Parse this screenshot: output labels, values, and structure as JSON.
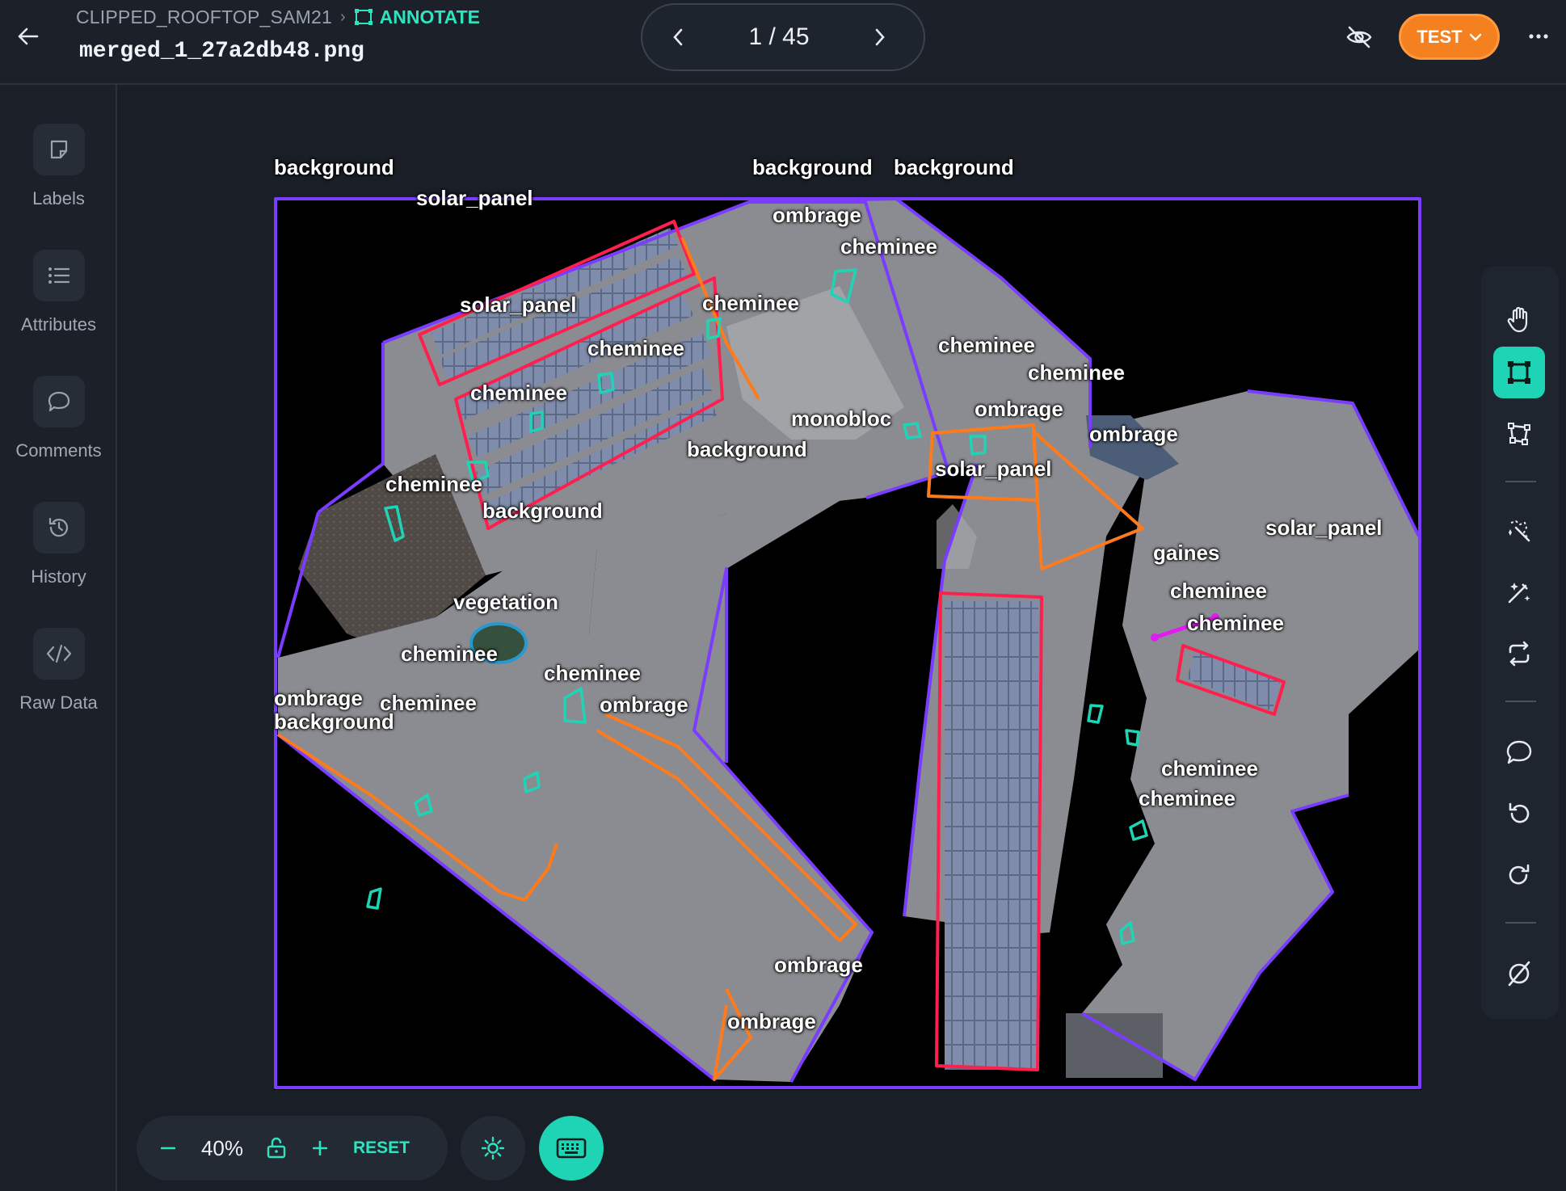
{
  "header": {
    "project": "CLIPPED_ROOFTOP_SAM21",
    "mode": "ANNOTATE",
    "filename": "merged_1_27a2db48.png",
    "pager": "1 / 45",
    "test_button": "TEST"
  },
  "sidebar": {
    "items": [
      {
        "label": "Labels",
        "icon": "label-tag-icon"
      },
      {
        "label": "Attributes",
        "icon": "list-icon"
      },
      {
        "label": "Comments",
        "icon": "comment-icon"
      },
      {
        "label": "History",
        "icon": "history-icon"
      },
      {
        "label": "Raw Data",
        "icon": "code-icon"
      }
    ]
  },
  "canvas": {
    "labels": {
      "top_bg_left": "background",
      "top_bg_mid": "background",
      "top_bg_right": "background",
      "solar_panel_top": "solar_panel",
      "ombrage_1": "ombrage",
      "cheminee_1": "cheminee",
      "solar_panel_2": "solar_panel",
      "cheminee_2": "cheminee",
      "cheminee_3": "cheminee",
      "cheminee_4": "cheminee",
      "cheminee_5": "cheminee",
      "cheminee_6": "cheminee",
      "ombrage_2": "ombrage",
      "monobloc": "monobloc",
      "ombrage_3": "ombrage",
      "background_1": "background",
      "solar_panel_3": "solar_panel",
      "cheminee_7": "cheminee",
      "background_2": "background",
      "solar_panel_4": "solar_panel",
      "gaines": "gaines",
      "cheminee_8": "cheminee",
      "cheminee_9": "cheminee",
      "vegetation": "vegetation",
      "cheminee_10": "cheminee",
      "cheminee_11": "cheminee",
      "ombrage_4": "ombrage",
      "cheminee_12": "cheminee",
      "ombrage_5": "ombrage",
      "background_3": "background",
      "cheminee_13": "cheminee",
      "cheminee_14": "cheminee",
      "ombrage_6": "ombrage",
      "ombrage_7": "ombrage"
    }
  },
  "zoom": {
    "value": "40%",
    "reset": "RESET"
  },
  "colors": {
    "accent": "#1fd4b4",
    "test": "#f58020",
    "outline_purple": "#7a3cff",
    "solar_red": "#ff1f4f",
    "ombrage_orange": "#ff7a1a",
    "cheminee_teal": "#1fd4b4",
    "vegetation_blue": "#1e9bd7",
    "gaines_magenta": "#e11cf0"
  },
  "toolbar": {
    "tools": [
      "hand-icon",
      "bbox-icon",
      "polygon-icon",
      "magic-wand-icon",
      "auto-annotate-icon",
      "swap-icon",
      "comment-icon",
      "undo-icon",
      "redo-icon",
      "clear-icon"
    ]
  }
}
